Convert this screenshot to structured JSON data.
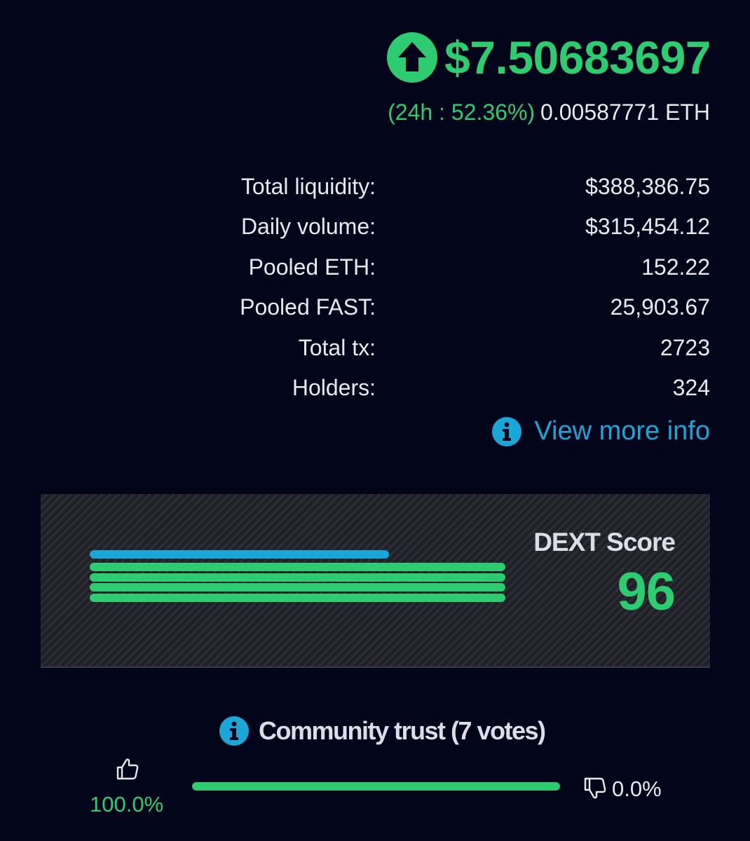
{
  "price": {
    "value": "$7.50683697",
    "icon": "arrow-up-circle-icon",
    "change_24h": "(24h : 52.36%)",
    "eth_value": "0.00587771 ETH"
  },
  "stats": [
    {
      "label": "Total liquidity:",
      "value": "$388,386.75"
    },
    {
      "label": "Daily volume:",
      "value": "$315,454.12"
    },
    {
      "label": "Pooled ETH:",
      "value": "152.22"
    },
    {
      "label": "Pooled FAST:",
      "value": "25,903.67"
    },
    {
      "label": "Total tx:",
      "value": "2723"
    },
    {
      "label": "Holders:",
      "value": "324"
    }
  ],
  "more_info": {
    "icon": "info-icon",
    "label": "View more info"
  },
  "dext_score": {
    "title": "DEXT Score",
    "value": "96",
    "bars": [
      {
        "level": 0.72,
        "color": "#1aa6d6"
      },
      {
        "level": 1.0,
        "color": "#2ecc71"
      },
      {
        "level": 1.0,
        "color": "#2ecc71"
      },
      {
        "level": 1.0,
        "color": "#2ecc71"
      },
      {
        "level": 1.0,
        "color": "#2ecc71"
      }
    ]
  },
  "community": {
    "icon": "info-icon",
    "title": "Community trust (7 votes)",
    "up_icon": "thumbs-up-icon",
    "up_percent": "100.0%",
    "down_icon": "thumbs-down-icon",
    "down_percent": "0.0%",
    "trust_level": 1.0
  },
  "colors": {
    "background": "#03051a",
    "positive": "#2ecc71",
    "accent": "#1aa6d6",
    "text": "#e9e9ee"
  }
}
